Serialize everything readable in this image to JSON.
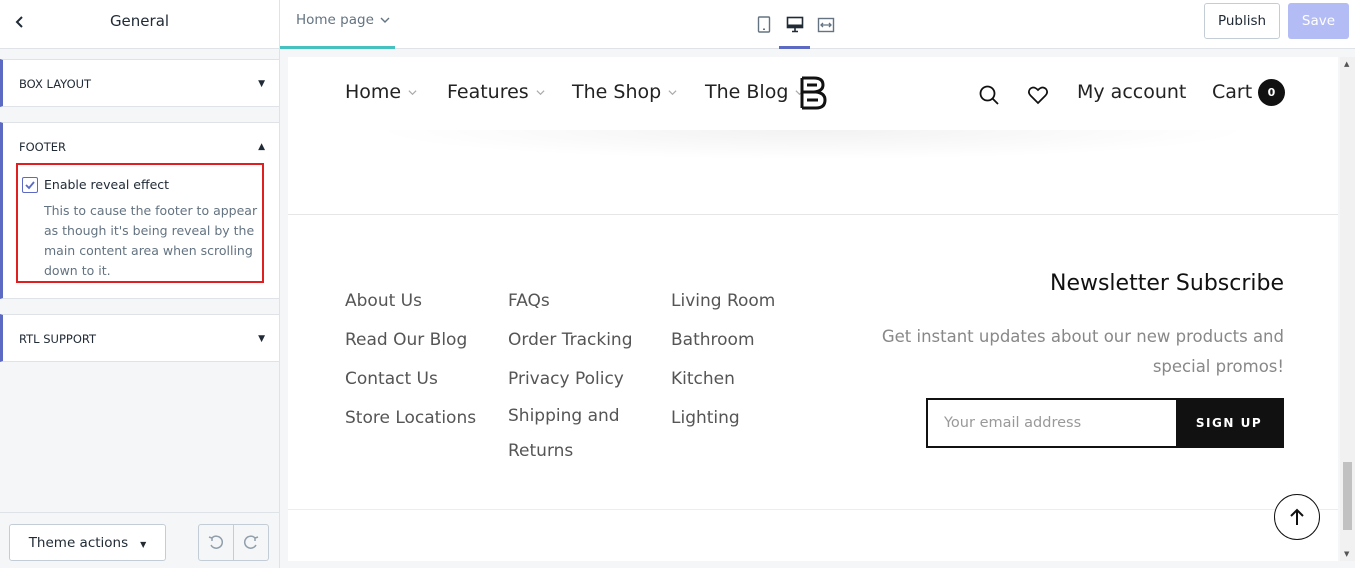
{
  "sidebar": {
    "title": "General",
    "sections": {
      "box_layout": {
        "label": "BOX LAYOUT",
        "state": "collapsed"
      },
      "footer": {
        "label": "FOOTER",
        "state": "expanded",
        "checkbox": {
          "label": "Enable reveal effect",
          "checked": true,
          "help": "This to cause the footer to appear as though it's being reveal by the main content area when scrolling down to it."
        }
      },
      "rtl_support": {
        "label": "RTL SUPPORT",
        "state": "collapsed"
      }
    },
    "footer": {
      "theme_actions_label": "Theme actions"
    }
  },
  "topbar": {
    "page_select": "Home page",
    "devices": [
      "mobile-icon",
      "desktop-icon",
      "fullwidth-icon"
    ],
    "active_device": "desktop",
    "publish_label": "Publish",
    "save_label": "Save"
  },
  "preview": {
    "nav": {
      "items": [
        "Home",
        "Features",
        "The Shop",
        "The Blog"
      ],
      "account_label": "My account",
      "cart_label": "Cart",
      "cart_count": "0"
    },
    "footer_links": {
      "col1": [
        "About Us",
        "Read Our Blog",
        "Contact Us",
        "Store Locations"
      ],
      "col2": [
        "FAQs",
        "Order Tracking",
        "Privacy Policy",
        "Shipping and",
        "Returns"
      ],
      "col3": [
        "Living Room",
        "Bathroom",
        "Kitchen",
        "Lighting"
      ]
    },
    "newsletter": {
      "title": "Newsletter Subscribe",
      "text": "Get instant updates about our new products and special promos!",
      "placeholder": "Your email address",
      "button_label": "SIGN UP"
    }
  },
  "colors": {
    "accent": "#5c6ac4",
    "tab_underline": "#47c1bf",
    "highlight_border": "#e02020",
    "save_disabled": "#b3bcf5"
  }
}
